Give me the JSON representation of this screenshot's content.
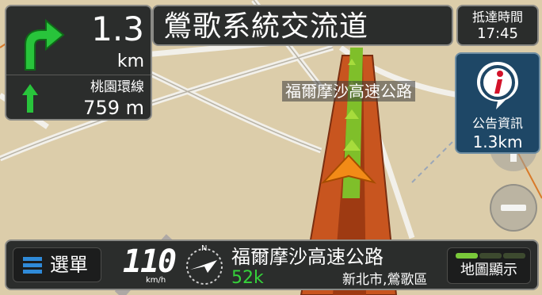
{
  "guidance": {
    "turn_distance": "1.3",
    "turn_distance_unit": "km",
    "next_road": "桃園環線",
    "next_distance": "759 m",
    "current_street": "鶯歌系統交流道"
  },
  "eta": {
    "label": "抵達時間",
    "time": "17:45"
  },
  "notice": {
    "label": "公告資訊",
    "distance": "1.3km"
  },
  "map": {
    "road_label": "福爾摩沙高速公路"
  },
  "bottom": {
    "menu_label": "選單",
    "speed": "110",
    "speed_unit": "km/h",
    "compass_north": "N",
    "current_road": "福爾摩沙高速公路",
    "road_distance": "52k",
    "district": "新北市,鶯歌區",
    "map_view_label": "地圖顯示",
    "map_view_level": 1
  },
  "colors": {
    "panel_bg": "#2b2d2c",
    "route_green": "#7fbf2a",
    "highway_orange": "#c8551f",
    "turn_arrow": "#28c43b",
    "notice_bg": "#1e4766",
    "distance_green": "#35d23a",
    "map_bg": "#d9c9a3"
  },
  "icons": {
    "turn": "turn-left-arrow-icon",
    "lane": "straight-arrow-icon",
    "notice": "info-pin-icon",
    "menu": "hamburger-menu-icon",
    "compass": "compass-icon",
    "position": "vehicle-position-arrow-icon",
    "zoom_in": "zoom-in-icon",
    "zoom_out": "zoom-out-icon"
  }
}
